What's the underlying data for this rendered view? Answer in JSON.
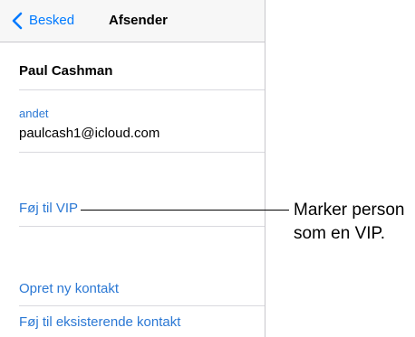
{
  "nav": {
    "back_label": "Besked",
    "title": "Afsender"
  },
  "contact": {
    "name": "Paul Cashman",
    "email_caption": "andet",
    "email": "paulcash1@icloud.com"
  },
  "actions": {
    "add_vip": "Føj til VIP",
    "create_contact": "Opret ny kontakt",
    "add_existing": "Føj til eksisterende kontakt"
  },
  "callout": {
    "line1": "Marker person",
    "line2": "som en VIP."
  },
  "colors": {
    "link": "#2b78d4",
    "nav_background": "#f7f7f7",
    "separator": "#d9d9de"
  },
  "icons": {
    "back": "chevron-left-icon"
  }
}
